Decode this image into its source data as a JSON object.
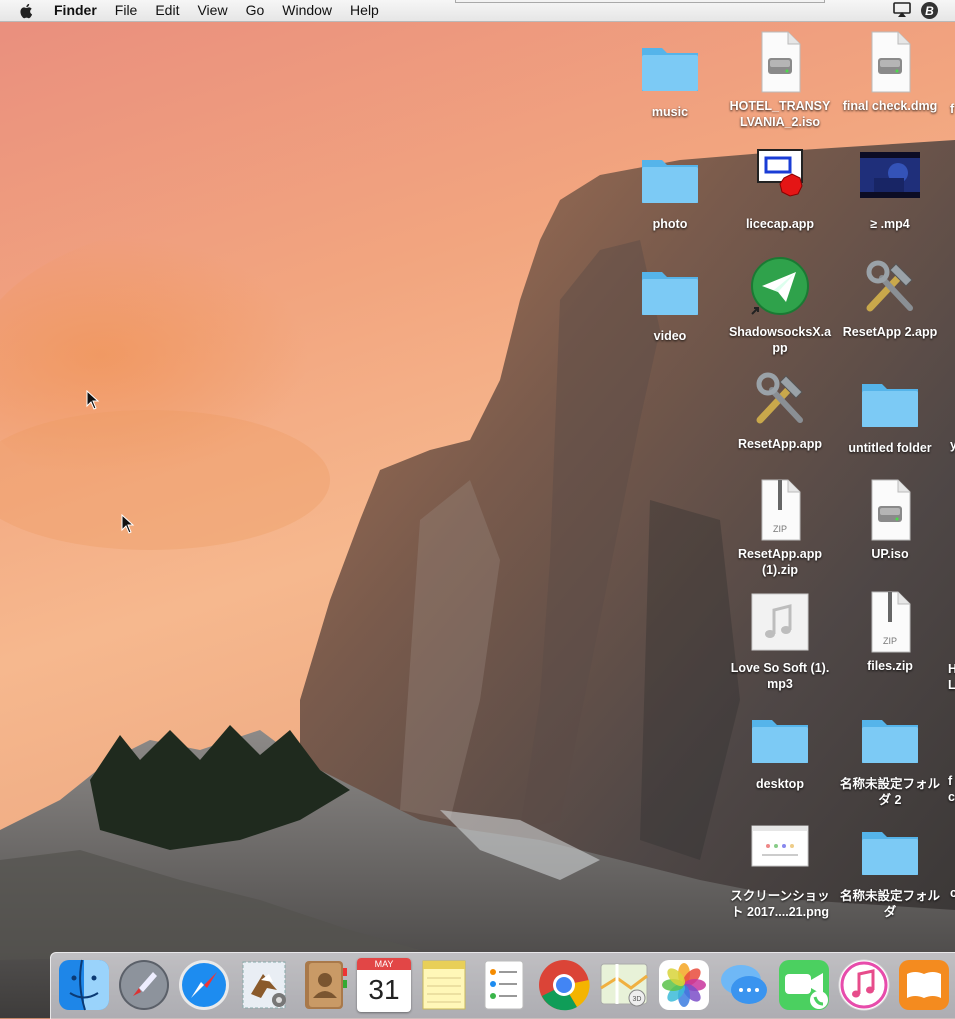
{
  "menubar": {
    "app_name": "Finder",
    "items": [
      "File",
      "Edit",
      "View",
      "Go",
      "Window",
      "Help"
    ],
    "status_icons": [
      "airplay-icon",
      "b-circle-icon"
    ]
  },
  "desktop": {
    "icons": [
      {
        "label": "music",
        "type": "folder"
      },
      {
        "label": "HOTEL_TRANSYLVANIA_2.iso",
        "type": "disk-image"
      },
      {
        "label": "final check.dmg",
        "type": "disk-image"
      },
      {
        "label": "photo",
        "type": "folder"
      },
      {
        "label": "licecap.app",
        "type": "app"
      },
      {
        "label": "≥ .mp4",
        "type": "video"
      },
      {
        "label": "video",
        "type": "folder"
      },
      {
        "label": "ShadowsocksX.app",
        "type": "app"
      },
      {
        "label": "ResetApp 2.app",
        "type": "app"
      },
      {
        "label": "ResetApp.app",
        "type": "app"
      },
      {
        "label": "untitled folder",
        "type": "folder"
      },
      {
        "label": "ResetApp.app (1).zip",
        "type": "zip"
      },
      {
        "label": "UP.iso",
        "type": "disk-image"
      },
      {
        "label": "Love So Soft (1).mp3",
        "type": "audio"
      },
      {
        "label": "files.zip",
        "type": "zip"
      },
      {
        "label": "desktop",
        "type": "folder"
      },
      {
        "label": "名称未設定フォルダ 2",
        "type": "folder"
      },
      {
        "label": "スクリーンショット 2017....21.png",
        "type": "image"
      },
      {
        "label": "名称未設定フォルダ",
        "type": "folder"
      }
    ],
    "edge_fragments": [
      "f",
      "y",
      "H",
      "L",
      "f",
      "c",
      "c"
    ]
  },
  "dock": {
    "apps": [
      "Finder",
      "Launchpad",
      "Safari",
      "Mail",
      "Contacts",
      "Calendar",
      "Notes",
      "Reminders",
      "Google Chrome",
      "Maps",
      "Photos",
      "Messages",
      "FaceTime",
      "iTunes",
      "iBooks"
    ],
    "calendar_month": "MAY",
    "calendar_day": "31"
  },
  "colors": {
    "folder": "#6ec3f3",
    "sky": "#e89a7a"
  }
}
